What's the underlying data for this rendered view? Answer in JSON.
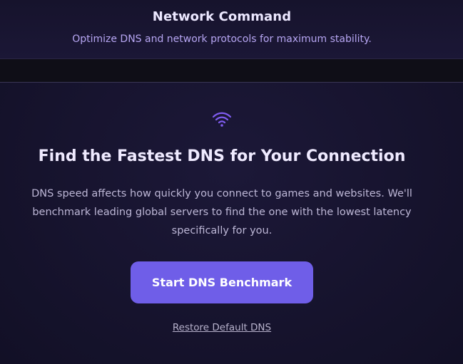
{
  "header": {
    "title": "Network Command",
    "subtitle": "Optimize DNS and network protocols for maximum stability."
  },
  "main": {
    "icon": "wifi-icon",
    "title": "Find the Fastest DNS for Your Connection",
    "description": "DNS speed affects how quickly you connect to games and websites. We'll benchmark leading global servers to find the one with the lowest latency specifically for you.",
    "primary_button_label": "Start DNS Benchmark",
    "secondary_link_label": "Restore Default DNS"
  },
  "colors": {
    "accent": "#6f5ee8",
    "background": "#15122a",
    "icon": "#7f5cf0"
  }
}
